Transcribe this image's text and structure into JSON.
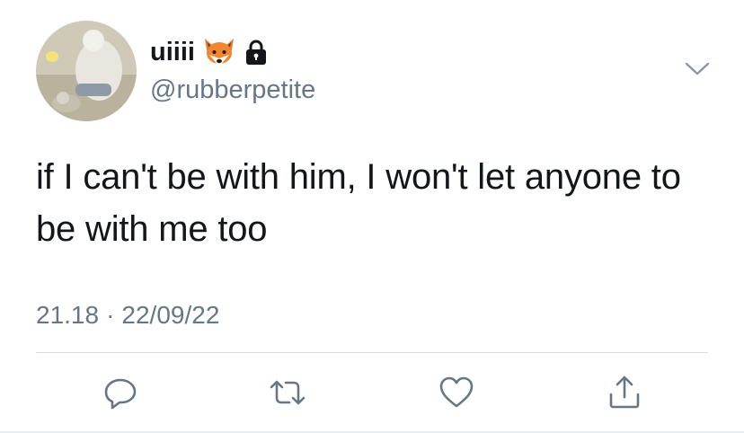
{
  "tweet": {
    "display_name": "uiiii",
    "handle": "@rubberpetite",
    "text": "if I can't be with him, I won't let anyone to be with me too",
    "time": "21.18",
    "separator": "·",
    "date": "22/09/22"
  },
  "icons": {
    "name_emoji": "fox-face-emoji",
    "protected": "lock-icon",
    "menu": "chevron-down-icon",
    "actions": [
      "reply-icon",
      "retweet-icon",
      "like-icon",
      "share-icon"
    ]
  },
  "colors": {
    "text": "#14171a",
    "secondary": "#657786",
    "icon": "#657786",
    "divider": "#d7dde2"
  }
}
